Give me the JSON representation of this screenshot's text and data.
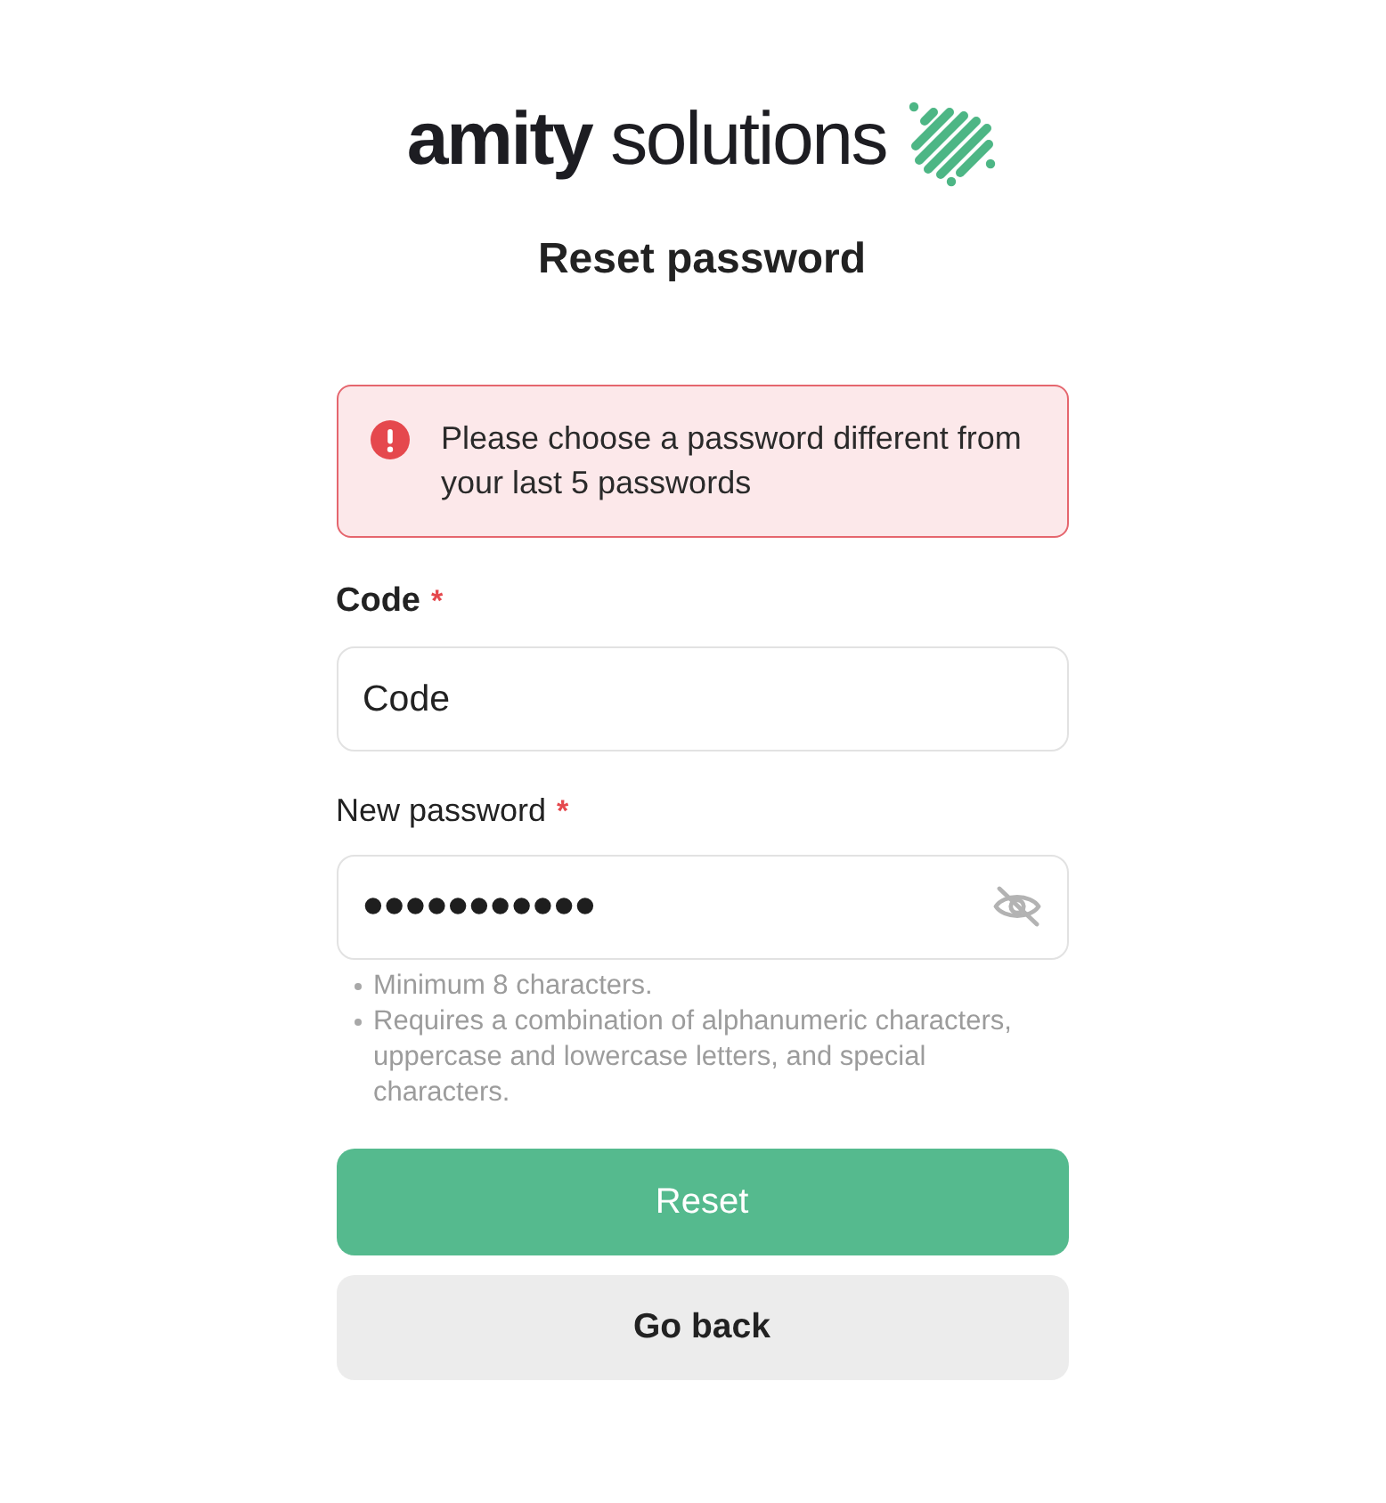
{
  "logo": {
    "text": "**amity** solutions"
  },
  "title": "Reset password",
  "alert": {
    "kind": "error",
    "message": "Please choose a password different from your last 5 passwords"
  },
  "fields": [
    {
      "kind": "text",
      "label": "Code",
      "required_mark": "*",
      "placeholder": "Code"
    },
    {
      "kind": "password",
      "label": "New password",
      "required_mark": "*",
      "value": "•••••••••••",
      "revealed": false,
      "hints": [
        "Minimum 8 characters.",
        "Requires a combination of alphanumeric characters, uppercase and lowercase letters, and special characters."
      ]
    }
  ],
  "buttons": [
    {
      "kind": "primary",
      "label": "Reset"
    },
    {
      "kind": "secondary",
      "label": "Go back"
    }
  ]
}
